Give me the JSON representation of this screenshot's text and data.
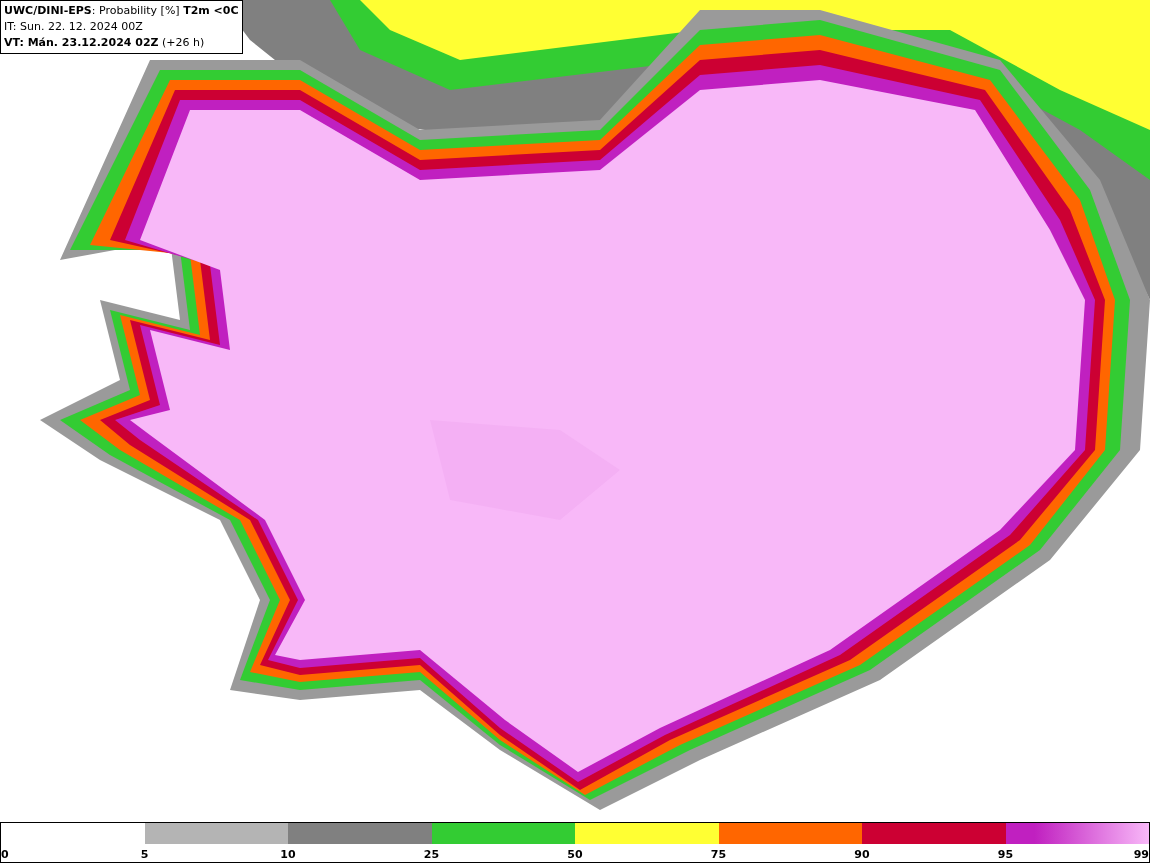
{
  "header": {
    "lines": [
      "**UWC/DINI-EPS**: Probability [%] **T2m <0C**",
      "IT: Sun. 22. 12. 2024 00Z",
      "**VT: Mán. 23.12.2024 02Z** (+26 h)"
    ]
  },
  "legend": {
    "segments": [
      {
        "color": "#b4b4b4"
      },
      {
        "color": "#808080"
      },
      {
        "color": "#33cc33"
      },
      {
        "color": "#ffff33"
      },
      {
        "color": "#ff6600"
      },
      {
        "color": "#cc0033"
      },
      {
        "color": "#c020c0"
      }
    ],
    "ticks": [
      "0",
      "5",
      "10",
      "25",
      "50",
      "75",
      "90",
      "95",
      "99"
    ]
  }
}
